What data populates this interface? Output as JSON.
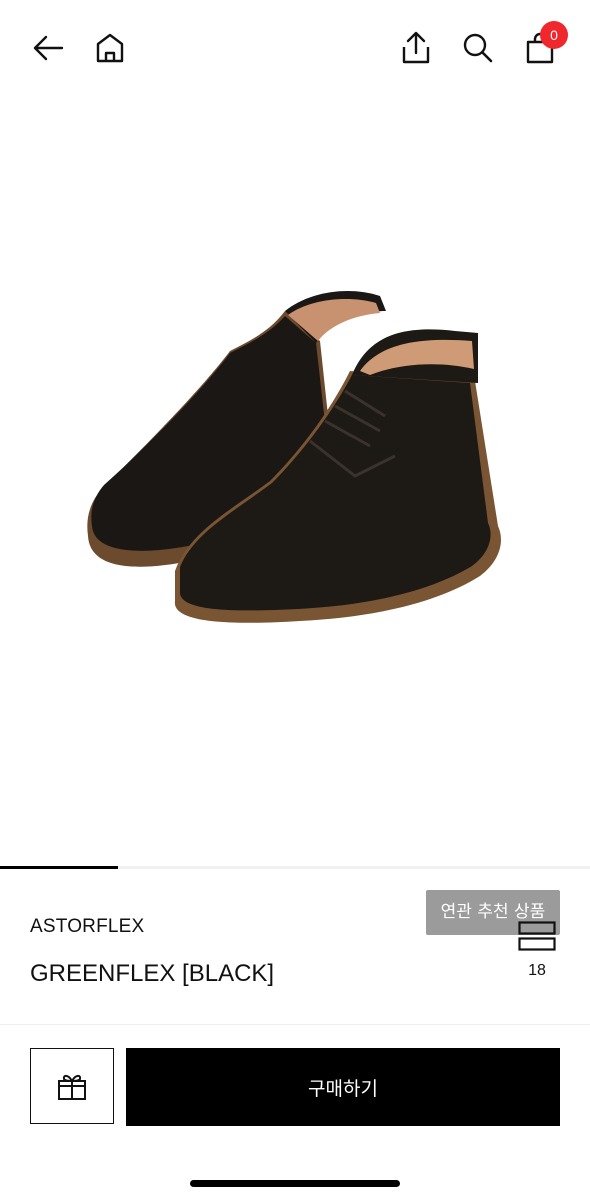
{
  "header": {
    "icons": [
      "back-arrow-icon",
      "home-icon",
      "share-icon",
      "search-icon",
      "shopping-bag-icon"
    ],
    "cart_count": "0",
    "badge_color": "#f0282d"
  },
  "gallery": {
    "related_button_label": "연관 추천 상품",
    "progress": 0.2
  },
  "product": {
    "brand": "ASTORFLEX",
    "name": "GREENFLEX [BLACK]",
    "like_count": "18"
  },
  "actions": {
    "buy_label": "구매하기"
  }
}
